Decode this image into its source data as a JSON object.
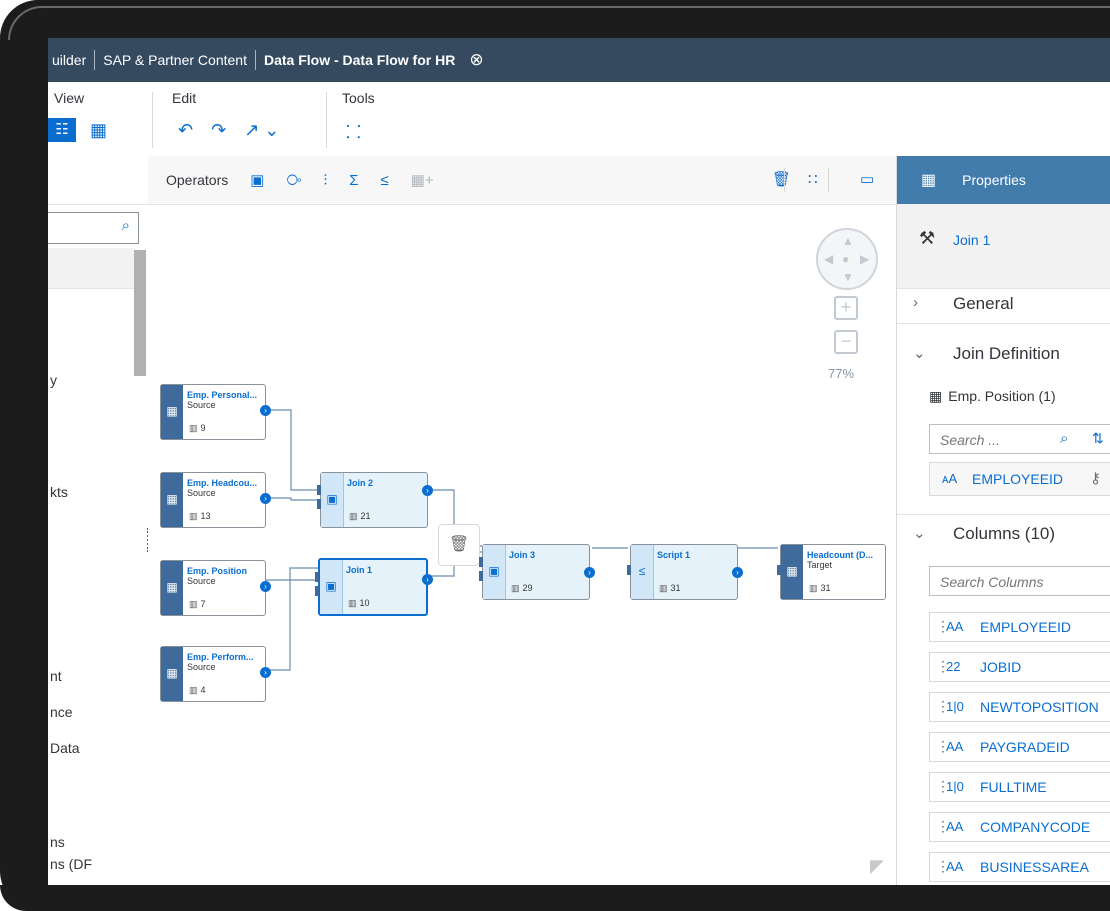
{
  "shell": {
    "crumbs": [
      "uilder",
      "SAP & Partner Content",
      "Data Flow - Data Flow for HR"
    ],
    "close_icon": "⊗"
  },
  "ribbon": {
    "view_label": "View",
    "edit_label": "Edit",
    "tools_label": "Tools"
  },
  "left_panel": {
    "items": [
      "y",
      "kts",
      "nt",
      "nce",
      "Data",
      "ns",
      "ns (DF"
    ]
  },
  "canvas": {
    "operators_label": "Operators",
    "zoom_level": "77%",
    "nodes": {
      "src1": {
        "name": "Emp. Personal...",
        "type": "Source",
        "count": "9"
      },
      "src2": {
        "name": "Emp. Headcou...",
        "type": "Source",
        "count": "13"
      },
      "src3": {
        "name": "Emp. Position",
        "type": "Source",
        "count": "7"
      },
      "src4": {
        "name": "Emp. Perform...",
        "type": "Source",
        "count": "4"
      },
      "join2": {
        "name": "Join 2",
        "count": "21"
      },
      "join1": {
        "name": "Join 1",
        "count": "10"
      },
      "join3": {
        "name": "Join 3",
        "count": "29"
      },
      "script1": {
        "name": "Script 1",
        "count": "31"
      },
      "target": {
        "name": "Headcount (D...",
        "type": "Target",
        "count": "31"
      }
    }
  },
  "properties": {
    "title": "Properties",
    "object_name": "Join 1",
    "general_label": "General",
    "join_def_label": "Join Definition",
    "join_table": "Emp. Position (1)",
    "search_placeholder": "Search ...",
    "join_key": "EMPLOYEEID",
    "columns_label": "Columns (10)",
    "columns_search_placeholder": "Search Columns",
    "columns": [
      {
        "type": "AA",
        "name": "EMPLOYEEID"
      },
      {
        "type": "22",
        "name": "JOBID"
      },
      {
        "type": "1|0",
        "name": "NEWTOPOSITION"
      },
      {
        "type": "AA",
        "name": "PAYGRADEID"
      },
      {
        "type": "1|0",
        "name": "FULLTIME"
      },
      {
        "type": "AA",
        "name": "COMPANYCODE"
      },
      {
        "type": "AA",
        "name": "BUSINESSAREA"
      }
    ]
  },
  "colors": {
    "shell": "#354a5f",
    "accent": "#0a6ed1",
    "properties_header": "#427cac",
    "source_band": "#3e6b9c"
  }
}
